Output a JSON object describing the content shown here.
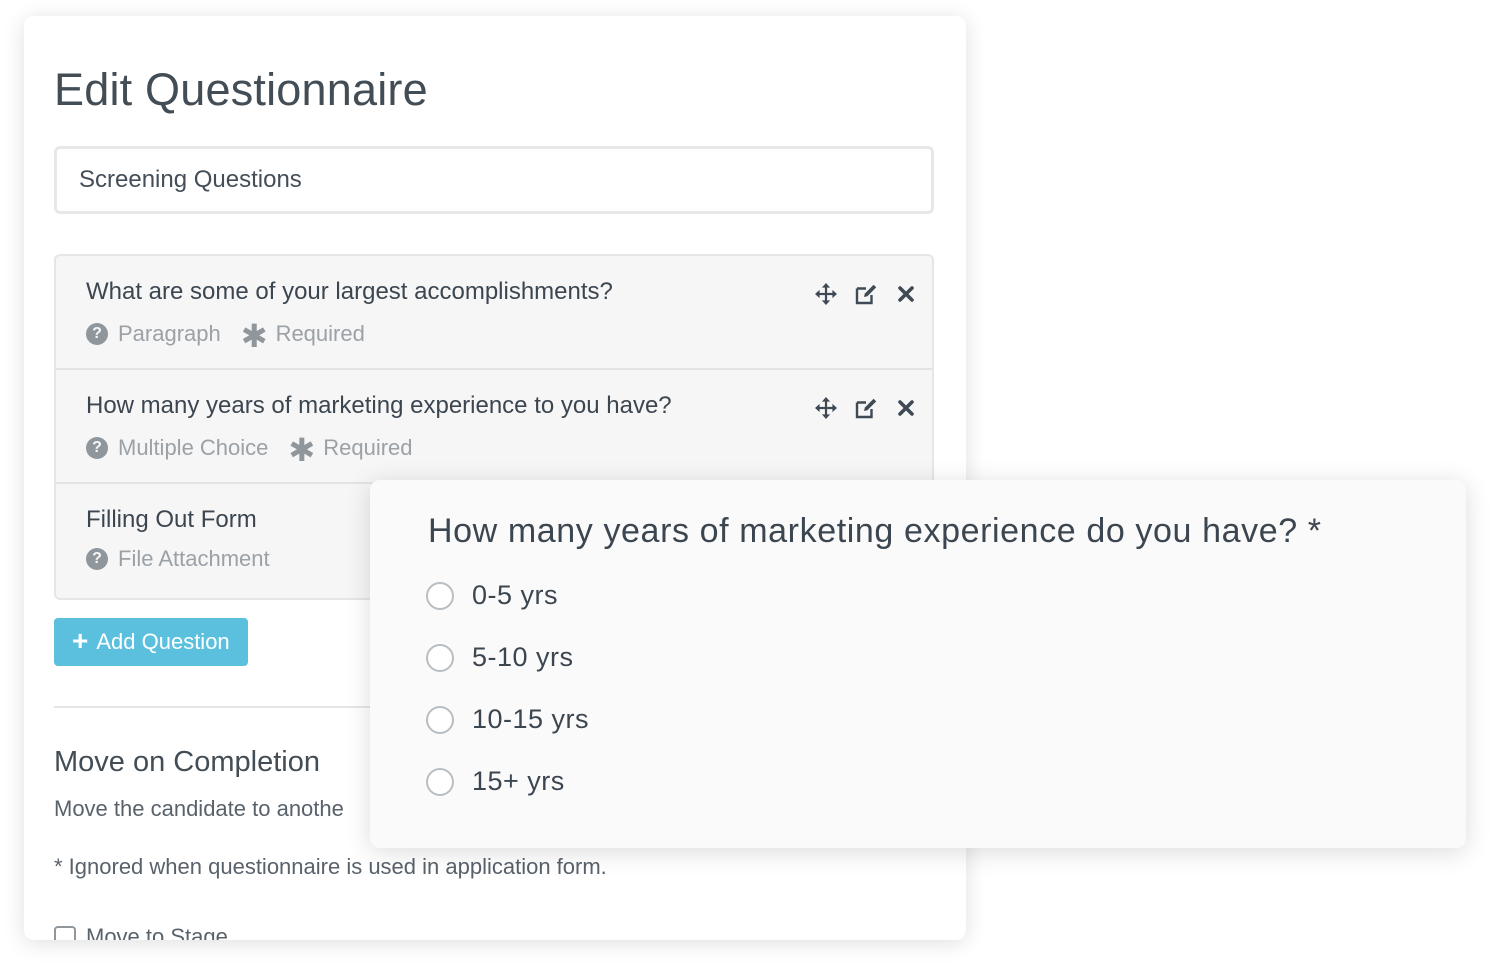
{
  "editor": {
    "title": "Edit Questionnaire",
    "questionnaire_name": "Screening Questions",
    "questions": [
      {
        "text": "What are some of your largest accomplishments?",
        "type": "Paragraph",
        "required_label": "Required"
      },
      {
        "text": "How many years of marketing experience to you have?",
        "type": "Multiple Choice",
        "required_label": "Required"
      },
      {
        "text": "Filling Out Form",
        "type": "File Attachment"
      }
    ],
    "add_question_label": "Add Question",
    "move_section": {
      "title": "Move on Completion",
      "description": "Move the candidate to anothe",
      "note": "* Ignored when questionnaire is used in application form.",
      "stage_option_label": "Move to Stage"
    }
  },
  "preview": {
    "question": "How many years of marketing experience do you have? *",
    "options": [
      "0-5 yrs",
      "5-10 yrs",
      "10-15 yrs",
      "15+ yrs"
    ]
  },
  "colors": {
    "accent": "#5bc0de",
    "icon": "#3f4a55",
    "muted": "#9aa1a7"
  },
  "icons": {
    "help": "question-circle-icon",
    "required": "asterisk-icon",
    "move": "move-arrows-icon",
    "edit": "edit-icon",
    "delete": "close-icon",
    "add": "plus-icon"
  }
}
